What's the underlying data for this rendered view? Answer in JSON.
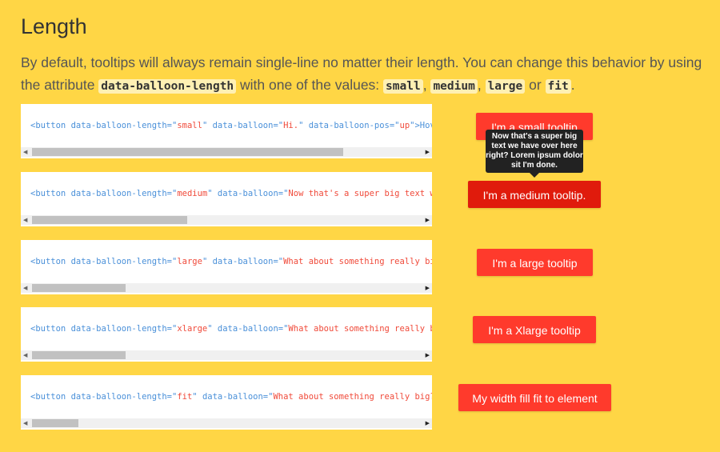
{
  "title": "Length",
  "description": {
    "part1": "By default, tooltips will always remain single-line no matter their length. You can change this behavior by using the attribute ",
    "attr": "data-balloon-length",
    "part2": " with one of the values: ",
    "v1": "small",
    "sep1": ", ",
    "v2": "medium",
    "sep2": ", ",
    "v3": "large",
    "sep3": " or ",
    "v4": "fit",
    "end": "."
  },
  "examples": [
    {
      "pre": "<button data-balloon-length=\"",
      "val": "small",
      "mid": "\" data-balloon=\"",
      "msg": "Hi.",
      "post": "\" data-balloon-pos=\"",
      "pos": "up",
      "tail": "\">Hov",
      "button": "I'm a small tooltip",
      "scroll_percent": 80
    },
    {
      "pre": "<button data-balloon-length=\"",
      "val": "medium",
      "mid": "\" data-balloon=\"",
      "msg": "Now that's a super big text w",
      "button": "I'm a medium tooltip.",
      "scroll_percent": 40
    },
    {
      "pre": "<button data-balloon-length=\"",
      "val": "large",
      "mid": "\" data-balloon=\"",
      "msg": "What about something really bi",
      "button": "I'm a large tooltip",
      "scroll_percent": 24
    },
    {
      "pre": "<button data-balloon-length=\"",
      "val": "xlarge",
      "mid": "\" data-balloon=\"",
      "msg": "What about something really b",
      "button": "I'm a Xlarge tooltip",
      "scroll_percent": 24
    },
    {
      "pre": "<button data-balloon-length=\"",
      "val": "fit",
      "mid": "\" data-balloon=\"",
      "msg": "What about something really big?",
      "button": "My width fill fit to element",
      "scroll_percent": 12
    }
  ],
  "tooltip": "Now that's a super big text we have over here right? Lorem ipsum dolor sit I'm done.",
  "colors": {
    "background": "#ffd645",
    "button": "#ff3a2c",
    "button_active": "#e01b0c",
    "tooltip": "#222222"
  }
}
